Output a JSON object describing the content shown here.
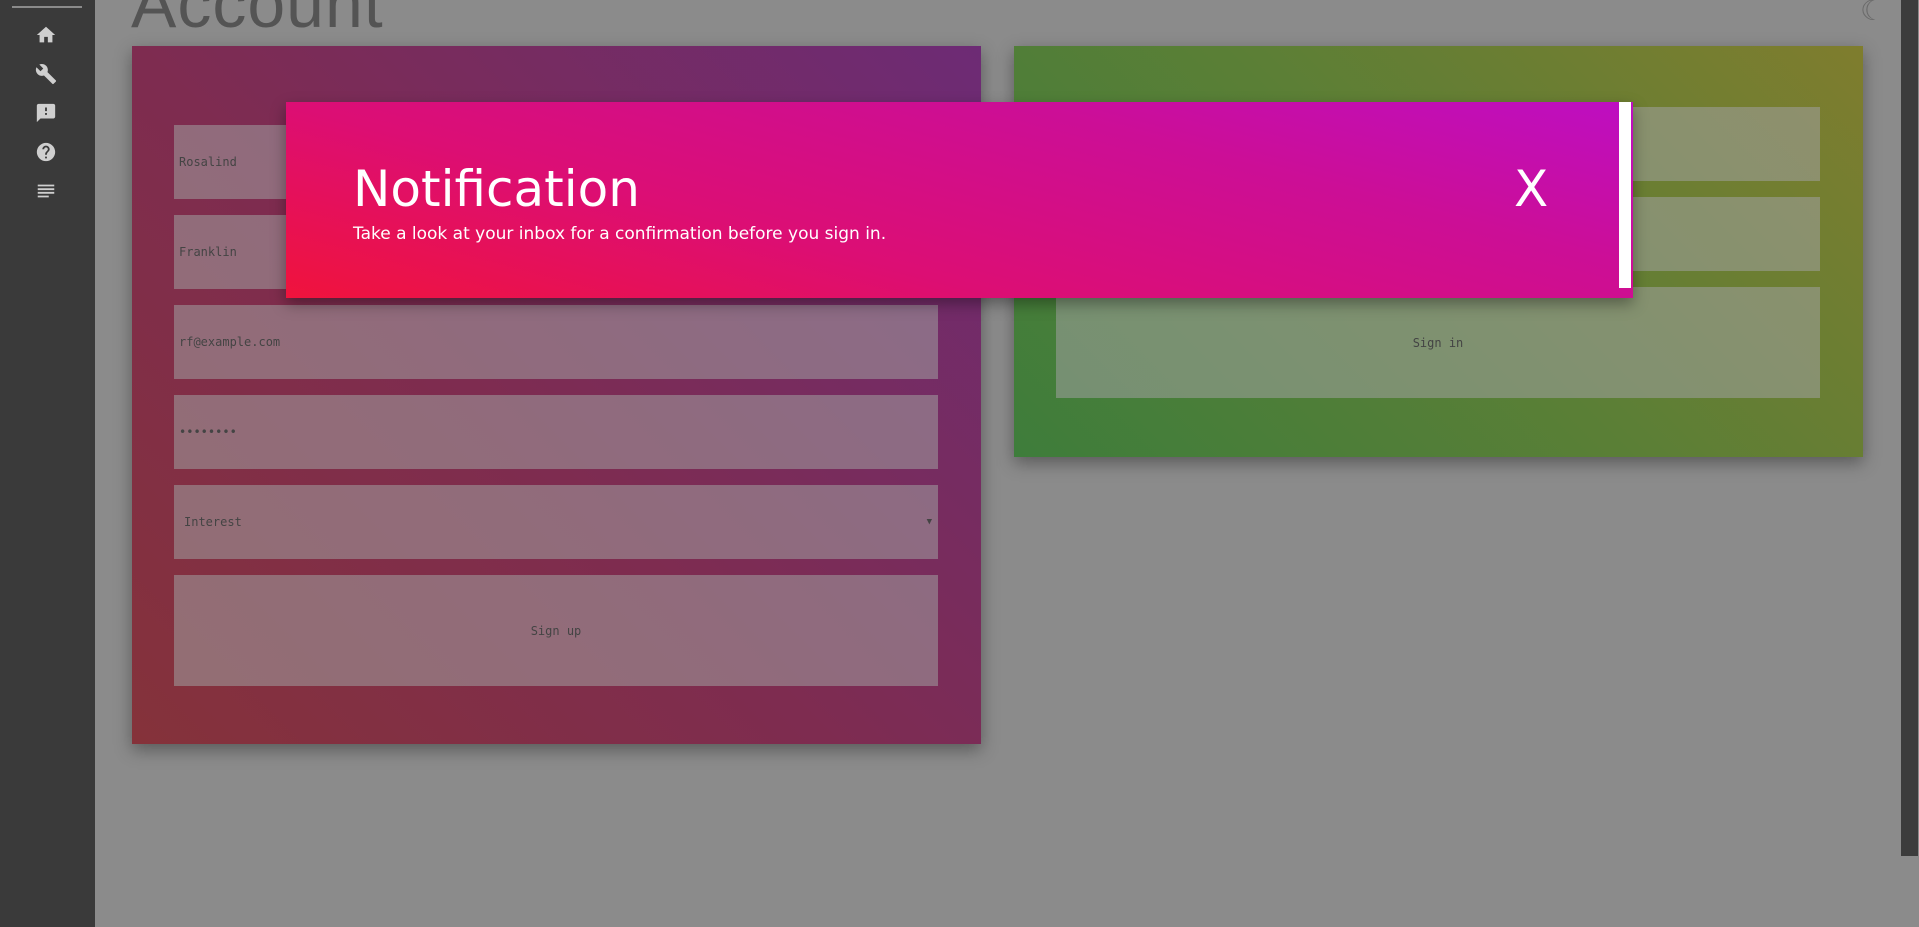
{
  "sidebar": {
    "items": [
      {
        "icon": "home-icon"
      },
      {
        "icon": "wrench-icon"
      },
      {
        "icon": "feedback-icon"
      },
      {
        "icon": "help-icon"
      },
      {
        "icon": "list-icon"
      }
    ]
  },
  "page": {
    "title": "Account"
  },
  "signup": {
    "first_name": "Rosalind",
    "last_name": "Franklin",
    "email_placeholder": "rf@example.com",
    "password": "••••••••",
    "interest_placeholder": "Interest",
    "button_label": "Sign up"
  },
  "signin": {
    "button_label": "Sign in"
  },
  "notification": {
    "title": "Notification",
    "message": "Take a look at your inbox for a confirmation before you sign in.",
    "close_label": "X"
  },
  "colors": {
    "sidebar": "#3a3a3a",
    "signup_card": "#7e2c50",
    "signin_card": "#5b7f36",
    "modal_start": "#f0133c",
    "modal_end": "#bd0ec2"
  }
}
